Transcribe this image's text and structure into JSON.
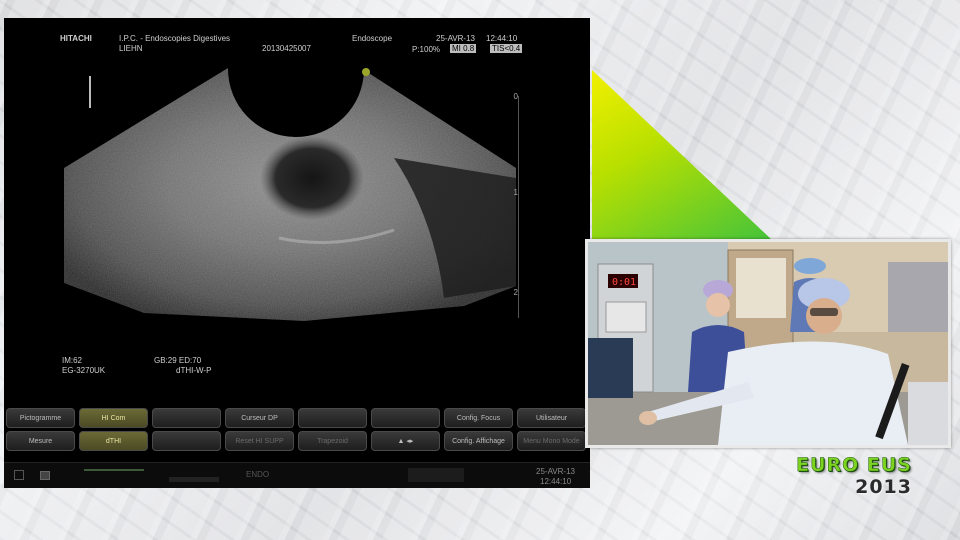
{
  "ultrasound": {
    "header": {
      "brand": "HITACHI",
      "institution": "I.P.C. - Endoscopies Digestives",
      "operator": "LIEHN",
      "exam_id": "20130425007",
      "probe_mode": "Endoscope",
      "date": "25-AVR-13",
      "time": "12:44:10",
      "power": "P:100%",
      "mi": "MI 0.8",
      "tis": "TIS<0.4"
    },
    "depth_scale": [
      "0",
      "1",
      "2"
    ],
    "params_left": {
      "im": "IM:62",
      "probe": "EG-3270UK"
    },
    "params_right": {
      "gb_ed": "GB:29  ED:70",
      "mode": "dTHI-W-P"
    },
    "buttons": [
      {
        "label": "Pictogramme",
        "state": "normal"
      },
      {
        "label": "HI Com",
        "state": "active"
      },
      {
        "label": "",
        "state": "normal"
      },
      {
        "label": "Curseur DP",
        "state": "normal"
      },
      {
        "label": "",
        "state": "normal"
      },
      {
        "label": "",
        "state": "normal"
      },
      {
        "label": "Config. Focus",
        "state": "normal"
      },
      {
        "label": "Utilisateur",
        "state": "normal"
      },
      {
        "label": "Mesure",
        "state": "normal"
      },
      {
        "label": "dTHI",
        "state": "active"
      },
      {
        "label": "",
        "state": "normal"
      },
      {
        "label": "Reset HI SUPP",
        "state": "dim"
      },
      {
        "label": "Trapezoid",
        "state": "dim"
      },
      {
        "label": "▲ ◂▸",
        "state": "normal"
      },
      {
        "label": "Config. Affichage",
        "state": "normal"
      },
      {
        "label": "Menu Mono Mode",
        "state": "dim"
      }
    ],
    "status": {
      "mode": "ENDO",
      "date": "25-AVR-13",
      "time": "12:44:10"
    }
  },
  "video": {
    "monitor_readout": "0:01"
  },
  "logo": {
    "line1": "EURO EUS",
    "line2": "2013"
  },
  "colors": {
    "triangle_top": "#f2f000",
    "triangle_bottom": "#44c33a",
    "logo_green": "#7ed321",
    "active_button": "#5a592d"
  }
}
